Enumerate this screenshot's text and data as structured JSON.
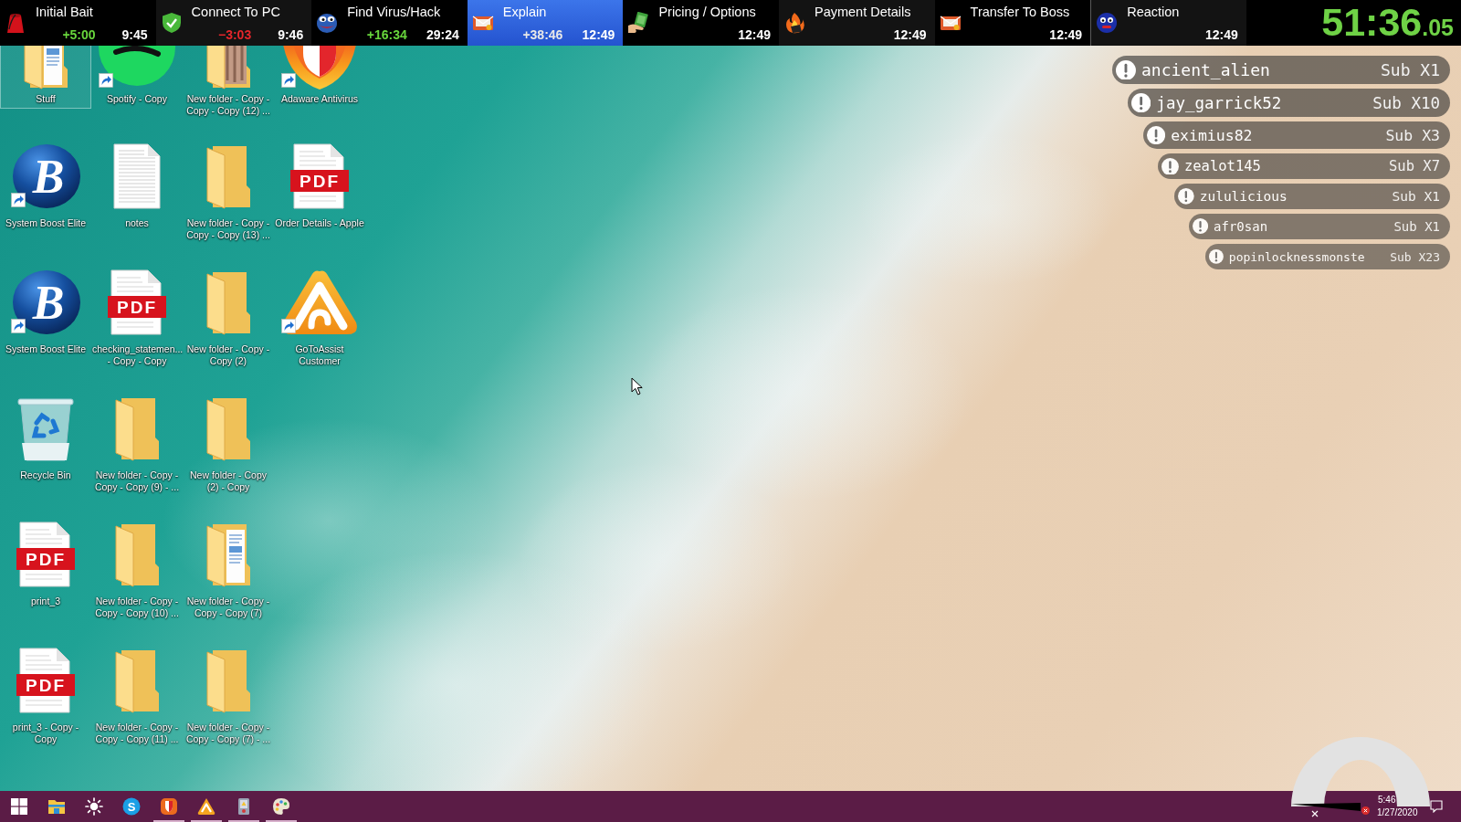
{
  "splits": [
    {
      "kind": "fez",
      "name": "Initial Bait",
      "delta": {
        "text": "+5:00",
        "color": "#68d63c"
      },
      "time": "9:45",
      "selected": false
    },
    {
      "kind": "shield",
      "name": "Connect To PC",
      "delta": {
        "text": "−3:03",
        "color": "#e4262b"
      },
      "time": "9:46",
      "selected": false
    },
    {
      "kind": "frog",
      "name": "Find Virus/Hack",
      "delta": {
        "text": "+16:34",
        "color": "#68d63c"
      },
      "time": "29:24",
      "selected": false
    },
    {
      "kind": "envelope",
      "name": "Explain",
      "delta": {
        "text": "+38:46",
        "color": "#e8e8e8"
      },
      "time": "12:49",
      "selected": true
    },
    {
      "kind": "cash",
      "name": "Pricing / Options",
      "time": "12:49",
      "selected": false
    },
    {
      "kind": "flame",
      "name": "Payment Details",
      "time": "12:49",
      "selected": false
    },
    {
      "kind": "envelope",
      "name": "Transfer To Boss",
      "time": "12:49",
      "selected": false
    },
    {
      "kind": "face",
      "name": "Reaction",
      "time": "12:49",
      "selected": false
    }
  ],
  "timer": {
    "main": "51:36",
    "fraction": ".05"
  },
  "desktop_icons": [
    {
      "label": "Stuff",
      "kind": "folder-docs",
      "shortcut": false,
      "selected": true
    },
    {
      "label": "System Boost Elite",
      "kind": "boost",
      "glyph": "B",
      "shortcut": true,
      "selected": false
    },
    {
      "label": "System Boost Elite",
      "kind": "boost",
      "glyph": "B",
      "shortcut": true,
      "selected": false
    },
    {
      "label": "Recycle Bin",
      "kind": "recycle-bin",
      "shortcut": false,
      "selected": false
    },
    {
      "label": "print_3",
      "kind": "pdf",
      "glyph": "PDF",
      "shortcut": false,
      "selected": false
    },
    {
      "label": "print_3 - Copy - Copy",
      "kind": "pdf",
      "glyph": "PDF",
      "shortcut": false,
      "selected": false
    },
    {
      "label": "Spotify - Copy",
      "kind": "spotify",
      "shortcut": true,
      "selected": false
    },
    {
      "label": "notes",
      "kind": "text",
      "shortcut": false,
      "selected": false
    },
    {
      "label": "checking_statemen... - Copy - Copy",
      "kind": "pdf",
      "glyph": "PDF",
      "shortcut": false,
      "selected": false
    },
    {
      "label": "New folder - Copy - Copy - Copy (9) - ...",
      "kind": "folder",
      "shortcut": false,
      "selected": false
    },
    {
      "label": "New folder - Copy - Copy - Copy (10) ...",
      "kind": "folder",
      "shortcut": false,
      "selected": false
    },
    {
      "label": "New folder - Copy - Copy - Copy (11) ...",
      "kind": "folder",
      "shortcut": false,
      "selected": false
    },
    {
      "label": "New folder - Copy - Copy - Copy (12) ...",
      "kind": "folder-photos",
      "shortcut": false,
      "selected": false
    },
    {
      "label": "New folder - Copy - Copy - Copy (13) ...",
      "kind": "folder",
      "shortcut": false,
      "selected": false
    },
    {
      "label": "New folder - Copy - Copy (2)",
      "kind": "folder",
      "shortcut": false,
      "selected": false
    },
    {
      "label": "New folder - Copy (2) - Copy",
      "kind": "folder",
      "shortcut": false,
      "selected": false
    },
    {
      "label": "New folder - Copy - Copy - Copy (7)",
      "kind": "folder-docs",
      "shortcut": false,
      "selected": false
    },
    {
      "label": "New folder - Copy - Copy - Copy (7) - ...",
      "kind": "folder",
      "shortcut": false,
      "selected": false
    },
    {
      "label": "Adaware Antivirus",
      "kind": "adaware",
      "shortcut": true,
      "selected": false
    },
    {
      "label": "Order Details - Apple",
      "kind": "pdf",
      "glyph": "PDF",
      "shortcut": false,
      "selected": false
    },
    {
      "label": "GoToAssist Customer",
      "kind": "gotoassist",
      "shortcut": true,
      "selected": false
    }
  ],
  "sub_alerts": [
    {
      "user": "ancient_alien",
      "sub": "Sub X1"
    },
    {
      "user": "jay_garrick52",
      "sub": "Sub X10"
    },
    {
      "user": "eximius82",
      "sub": "Sub X3"
    },
    {
      "user": "zealot145",
      "sub": "Sub X7"
    },
    {
      "user": "zululicious",
      "sub": "Sub X1"
    },
    {
      "user": "afr0san",
      "sub": "Sub X1"
    },
    {
      "user": "popinlocknessmonste",
      "sub": "Sub X23"
    }
  ],
  "taskbar": {
    "apps": [
      {
        "kind": "start",
        "running": false
      },
      {
        "kind": "explorer",
        "running": false
      },
      {
        "kind": "sun",
        "running": false
      },
      {
        "kind": "skype",
        "glyph": "S",
        "running": false
      },
      {
        "kind": "adaware",
        "running": true
      },
      {
        "kind": "gotoassist",
        "running": true
      },
      {
        "kind": "device",
        "running": true
      },
      {
        "kind": "paint",
        "running": true
      }
    ],
    "tray": {
      "time": "5:46",
      "date": "1/27/2020"
    }
  }
}
